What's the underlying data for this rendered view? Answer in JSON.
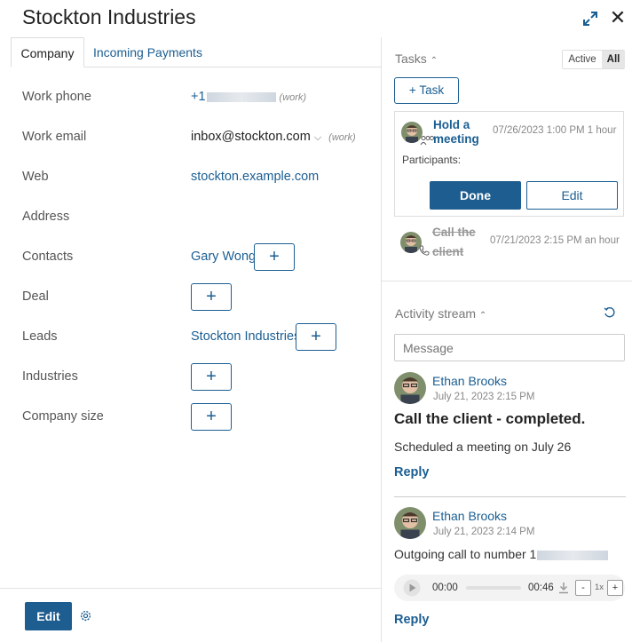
{
  "header": {
    "title": "Stockton Industries"
  },
  "tabs": [
    {
      "label": "Company"
    },
    {
      "label": "Incoming Payments"
    }
  ],
  "fields": {
    "work_phone": {
      "label": "Work phone",
      "value_prefix": "+1",
      "tag": "(work)"
    },
    "work_email": {
      "label": "Work email",
      "value": "inbox@stockton.com",
      "tag": "(work)"
    },
    "web": {
      "label": "Web",
      "value": "stockton.example.com"
    },
    "address": {
      "label": "Address"
    },
    "contacts": {
      "label": "Contacts",
      "value": "Gary Wong"
    },
    "deal": {
      "label": "Deal"
    },
    "leads": {
      "label": "Leads",
      "value": "Stockton Industries"
    },
    "industries": {
      "label": "Industries"
    },
    "company_size": {
      "label": "Company size"
    }
  },
  "add_symbol": "+",
  "footer": {
    "edit_label": "Edit"
  },
  "tasks": {
    "title": "Tasks",
    "toggle_active": "Active",
    "toggle_all": "All",
    "add_task": "+ Task",
    "card": {
      "title": "Hold a meeting",
      "date": "07/26/2023 1:00 PM",
      "duration": "1 hour",
      "participants_label": "Participants:",
      "done_label": "Done",
      "edit_label": "Edit"
    },
    "completed": {
      "title": "Call the client",
      "date": "07/21/2023 2:15 PM",
      "duration": "an hour"
    }
  },
  "activity": {
    "title": "Activity stream",
    "message_placeholder": "Message",
    "items": [
      {
        "author": "Ethan Brooks",
        "date": "July 21, 2023 2:15 PM",
        "headline": "Call the client - completed.",
        "text": "Scheduled a meeting on July 26",
        "reply": "Reply"
      },
      {
        "author": "Ethan Brooks",
        "date": "July 21, 2023 2:14 PM",
        "text": "Outgoing call to number 1",
        "reply": "Reply",
        "audio": {
          "current": "00:00",
          "total": "00:46",
          "speed": "1x",
          "minus": "-",
          "plus": "+"
        }
      }
    ]
  },
  "colors": {
    "accent": "#1b5e92",
    "primary_button": "#1e5d8f"
  }
}
